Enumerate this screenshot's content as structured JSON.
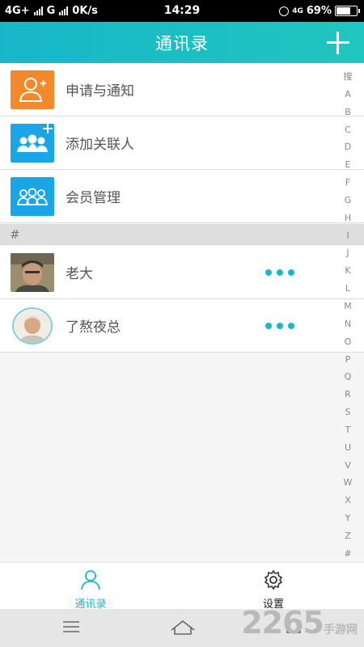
{
  "status_bar": {
    "network1": "4G+",
    "network2": "G",
    "speed": "0K/s",
    "time": "14:29",
    "network_right": "4G",
    "battery": "69%",
    "battery_level": 0.69
  },
  "header": {
    "title": "通讯录",
    "add_icon": "plus-icon"
  },
  "menu": [
    {
      "label": "申请与通知",
      "icon": "user-add-icon",
      "color": "#f2892a"
    },
    {
      "label": "添加关联人",
      "icon": "group-add-icon",
      "color": "#1aa5e6"
    },
    {
      "label": "会员管理",
      "icon": "members-icon",
      "color": "#1aa5e6"
    }
  ],
  "section": "#",
  "contacts": [
    {
      "name": "老大",
      "more_icon": "more-dots-icon"
    },
    {
      "name": "了熬夜总",
      "more_icon": "more-dots-icon"
    }
  ],
  "index_letters": [
    "搜",
    "A",
    "B",
    "C",
    "D",
    "E",
    "F",
    "G",
    "H",
    "I",
    "J",
    "K",
    "L",
    "M",
    "N",
    "O",
    "P",
    "Q",
    "R",
    "S",
    "T",
    "U",
    "V",
    "W",
    "X",
    "Y",
    "Z",
    "#"
  ],
  "tabs": [
    {
      "label": "通讯录",
      "icon": "person-icon",
      "active": true
    },
    {
      "label": "设置",
      "icon": "gear-icon",
      "active": false
    }
  ],
  "colors": {
    "accent": "#18b9c9",
    "orange": "#f2892a",
    "blue": "#1aa5e6"
  },
  "watermark": {
    "number": "2265",
    "suffix": "手游网"
  }
}
